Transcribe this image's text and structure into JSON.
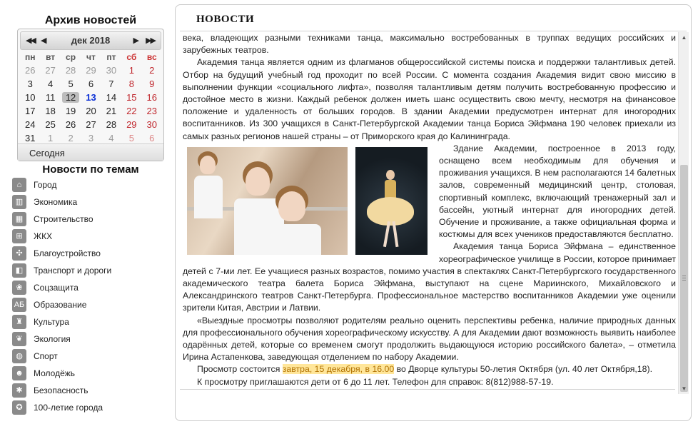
{
  "archive": {
    "title": "Архив новостей",
    "calendar": {
      "month_title": "дек 2018",
      "nav": {
        "prev_year": "◀◀",
        "prev_month": "◀",
        "next_month": "▶",
        "next_year": "▶▶"
      },
      "weekdays": [
        "пн",
        "вт",
        "ср",
        "чт",
        "пт",
        "сб",
        "вс"
      ],
      "weeks": [
        [
          {
            "d": "26",
            "o": true
          },
          {
            "d": "27",
            "o": true
          },
          {
            "d": "28",
            "o": true
          },
          {
            "d": "29",
            "o": true
          },
          {
            "d": "30",
            "o": true
          },
          {
            "d": "1"
          },
          {
            "d": "2"
          }
        ],
        [
          {
            "d": "3"
          },
          {
            "d": "4"
          },
          {
            "d": "5"
          },
          {
            "d": "6"
          },
          {
            "d": "7"
          },
          {
            "d": "8"
          },
          {
            "d": "9"
          }
        ],
        [
          {
            "d": "10"
          },
          {
            "d": "11"
          },
          {
            "d": "12",
            "sel": true
          },
          {
            "d": "13",
            "today": true
          },
          {
            "d": "14"
          },
          {
            "d": "15"
          },
          {
            "d": "16"
          }
        ],
        [
          {
            "d": "17"
          },
          {
            "d": "18"
          },
          {
            "d": "19"
          },
          {
            "d": "20"
          },
          {
            "d": "21"
          },
          {
            "d": "22"
          },
          {
            "d": "23"
          }
        ],
        [
          {
            "d": "24"
          },
          {
            "d": "25"
          },
          {
            "d": "26"
          },
          {
            "d": "27"
          },
          {
            "d": "28"
          },
          {
            "d": "29"
          },
          {
            "d": "30"
          }
        ],
        [
          {
            "d": "31"
          },
          {
            "d": "1",
            "o": true
          },
          {
            "d": "2",
            "o": true
          },
          {
            "d": "3",
            "o": true
          },
          {
            "d": "4",
            "o": true
          },
          {
            "d": "5",
            "o": true
          },
          {
            "d": "6",
            "o": true
          }
        ]
      ],
      "today_label": "Сегодня"
    }
  },
  "topics": {
    "title": "Новости по темам",
    "items": [
      {
        "label": "Город",
        "icon": "city-icon",
        "glyph": "⌂"
      },
      {
        "label": "Экономика",
        "icon": "economy-icon",
        "glyph": "▥"
      },
      {
        "label": "Строительство",
        "icon": "construction-icon",
        "glyph": "▦"
      },
      {
        "label": "ЖКХ",
        "icon": "housing-icon",
        "glyph": "⊞"
      },
      {
        "label": "Благоустройство",
        "icon": "improvement-icon",
        "glyph": "✣"
      },
      {
        "label": "Транспорт и дороги",
        "icon": "transport-icon",
        "glyph": "◧"
      },
      {
        "label": "Соцзащита",
        "icon": "social-icon",
        "glyph": "❀"
      },
      {
        "label": "Образование",
        "icon": "education-icon",
        "glyph": "АБ"
      },
      {
        "label": "Культура",
        "icon": "culture-icon",
        "glyph": "♜"
      },
      {
        "label": "Экология",
        "icon": "ecology-icon",
        "glyph": "❦"
      },
      {
        "label": "Спорт",
        "icon": "sport-icon",
        "glyph": "◍"
      },
      {
        "label": "Молодёжь",
        "icon": "youth-icon",
        "glyph": "☻"
      },
      {
        "label": "Безопасность",
        "icon": "safety-icon",
        "glyph": "✱"
      },
      {
        "label": "100-летие города",
        "icon": "centenary-icon",
        "glyph": "✪"
      }
    ]
  },
  "news": {
    "title": "НОВОСТИ",
    "p1": "века, владеющих разными техниками танца, максимально востребованных в труппах ведущих российских и зарубежных театров.",
    "p2": "Академия танца является одним из флагманов общероссийской системы поиска и поддержки талантливых детей. Отбор на будущий учебный год проходит по всей России. С момента создания Академия видит свою миссию в выполнении функции «социального лифта», позволяя талантливым детям получить востребованную профессию и достойное место в жизни. Каждый ребенок должен иметь шанс осуществить свою мечту, несмотря на финансовое положение и удаленность от больших городов. В здании Академии предусмотрен интернат для иногородних воспитанников. Из 300 учащихся в Санкт-Петербургской Академии танца Бориса Эйфмана 190 человек приехали из самых разных регионов нашей страны – от Приморского края до Калининграда.",
    "p3": "Здание Академии, построенное в 2013 году, оснащено всем необходимым для обучения и проживания учащихся. В нем располагаются 14 балетных залов, современный медицинский центр, столовая, спортивный комплекс, включающий тренажерный зал и бассейн, уютный интернат для иногородних детей. Обучение и проживание, а также официальная форма и костюмы для всех учеников предоставляются бесплатно.",
    "p4": "Академия танца Бориса Эйфмана – единственное хореографическое училище в России, которое принимает детей с 7-ми лет. Ее учащиеся разных возрастов, помимо участия в спектаклях Санкт-Петербургского государственного академического театра балета Бориса Эйфмана, выступают на сцене Мариинского, Михайловского и Александринского театров Санкт-Петербурга. Профессиональное мастерство воспитанников Академии уже оценили зрители Китая, Австрии и Латвии.",
    "p5": "«Выездные просмотры позволяют родителям реально оценить перспективы ребенка, наличие природных данных для профессионального обучения хореографическому искусству. А для Академии дают возможность выявить наиболее одарённых детей, которые со временем смогут продолжить выдающуюся историю российского балета», – отметила Ирина Астапенкова, заведующая отделением по набору Академии.",
    "p6_before": "Просмотр состоится ",
    "p6_highlight": "завтра, 15 декабря, в 16.00",
    "p6_after": " во Дворце культуры 50-летия Октября (ул. 40 лет Октября,18).",
    "p7": "К просмотру приглашаются дети от 6 до 11 лет. Телефон для справок: 8(812)988-57-19."
  },
  "scrollbar": {
    "up": "▲",
    "down": "▼"
  }
}
